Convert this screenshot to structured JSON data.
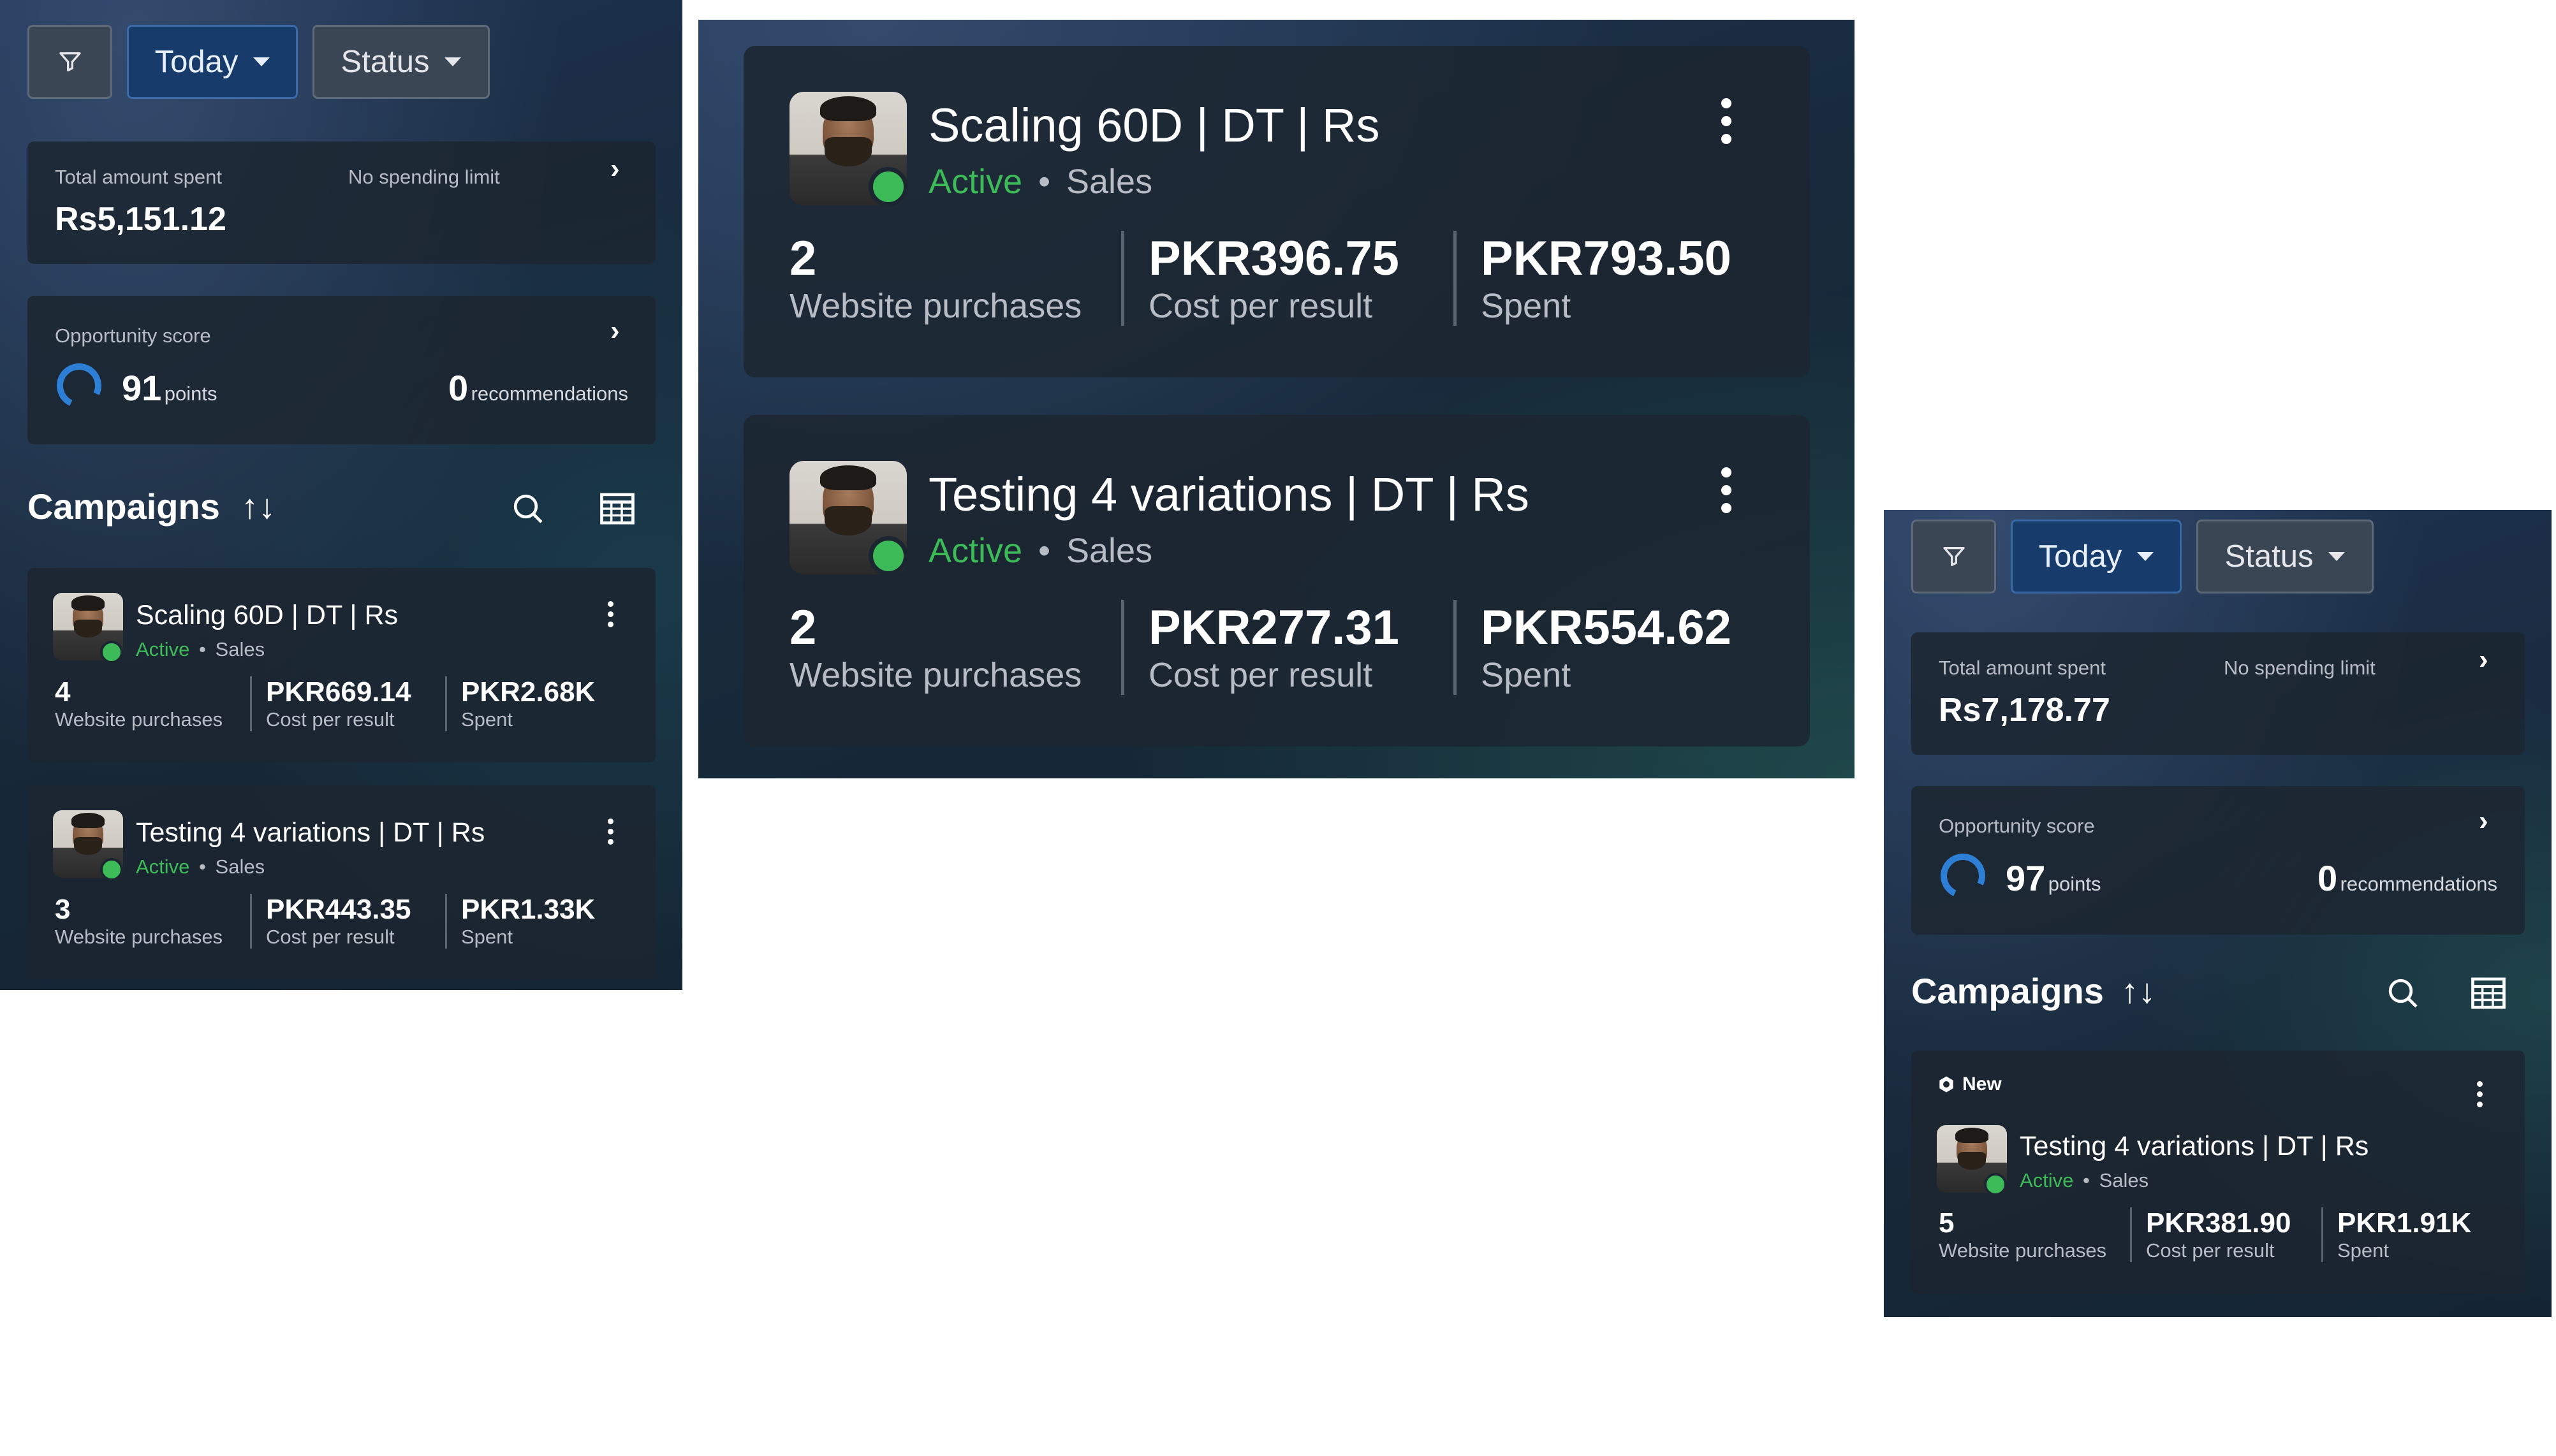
{
  "panel_a": {
    "filters": {
      "funnel_icon": "funnel-icon",
      "today": "Today",
      "status": "Status"
    },
    "total_spent": {
      "label": "Total amount spent",
      "limit": "No spending limit",
      "value": "Rs5,151.12"
    },
    "opportunity": {
      "label": "Opportunity score",
      "points": "91",
      "points_label": "points",
      "recs": "0",
      "recs_label": "recommendations"
    },
    "campaigns_title": "Campaigns",
    "campaigns": [
      {
        "name": "Scaling 60D | DT | Rs",
        "status": "Active",
        "separator": "•",
        "objective": "Sales",
        "m1": "4",
        "m1_label": "Website purchases",
        "m2": "PKR669.14",
        "m2_label": "Cost per result",
        "m3": "PKR2.68K",
        "m3_label": "Spent"
      },
      {
        "name": "Testing 4 variations | DT | Rs",
        "status": "Active",
        "separator": "•",
        "objective": "Sales",
        "m1": "3",
        "m1_label": "Website purchases",
        "m2": "PKR443.35",
        "m2_label": "Cost per result",
        "m3": "PKR1.33K",
        "m3_label": "Spent"
      }
    ]
  },
  "panel_b": {
    "campaigns": [
      {
        "name": "Scaling 60D | DT | Rs",
        "status": "Active",
        "separator": "•",
        "objective": "Sales",
        "m1": "2",
        "m1_label": "Website purchases",
        "m2": "PKR396.75",
        "m2_label": "Cost per result",
        "m3": "PKR793.50",
        "m3_label": "Spent"
      },
      {
        "name": "Testing 4 variations | DT | Rs",
        "status": "Active",
        "separator": "•",
        "objective": "Sales",
        "m1": "2",
        "m1_label": "Website purchases",
        "m2": "PKR277.31",
        "m2_label": "Cost per result",
        "m3": "PKR554.62",
        "m3_label": "Spent"
      }
    ]
  },
  "panel_c": {
    "filters": {
      "funnel_icon": "funnel-icon",
      "today": "Today",
      "status": "Status"
    },
    "total_spent": {
      "label": "Total amount spent",
      "limit": "No spending limit",
      "value": "Rs7,178.77"
    },
    "opportunity": {
      "label": "Opportunity score",
      "points": "97",
      "points_label": "points",
      "recs": "0",
      "recs_label": "recommendations"
    },
    "campaigns_title": "Campaigns",
    "campaigns": [
      {
        "badge": "New",
        "name": "Testing 4 variations | DT | Rs",
        "status": "Active",
        "separator": "•",
        "objective": "Sales",
        "m1": "5",
        "m1_label": "Website purchases",
        "m2": "PKR381.90",
        "m2_label": "Cost per result",
        "m3": "PKR1.91K",
        "m3_label": "Spent"
      }
    ]
  },
  "icons": {
    "sort": "↑↓",
    "chevron": "›",
    "search": "search-icon",
    "table": "table-icon"
  },
  "colors": {
    "active_green": "#3dbb58",
    "today_blue": "#173c6c",
    "ring_blue": "#2d7fd6"
  }
}
